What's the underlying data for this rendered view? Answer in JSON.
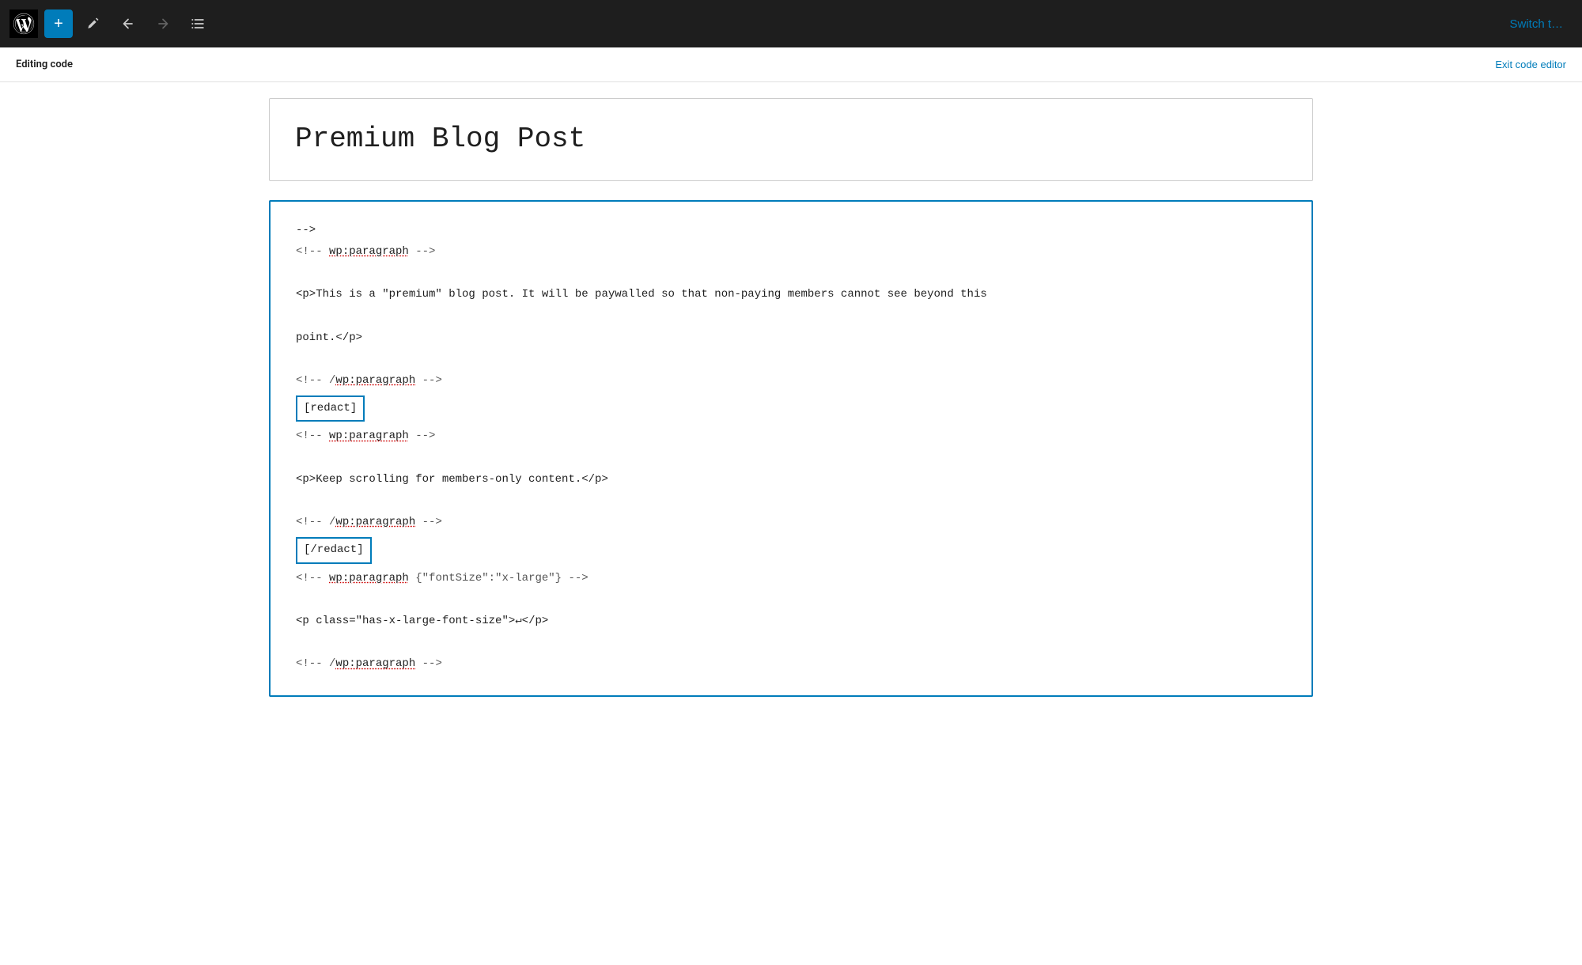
{
  "toolbar": {
    "add_label": "+",
    "switch_label": "Switch t…",
    "undo_title": "Undo",
    "redo_title": "Redo",
    "list_view_title": "List View",
    "edit_title": "Edit"
  },
  "editing_bar": {
    "label": "Editing code",
    "exit_label": "Exit code editor"
  },
  "post": {
    "title": "Premium Blog Post"
  },
  "code_editor": {
    "lines": [
      {
        "type": "comment",
        "content": "<!-- ",
        "tag": "wp:paragraph",
        "end": " -->"
      },
      {
        "type": "empty"
      },
      {
        "type": "text",
        "content": "<p>This is a \"premium\" blog post. It will be paywalled so that non-paying members cannot see beyond this"
      },
      {
        "type": "empty"
      },
      {
        "type": "text",
        "content": "point.</p>"
      },
      {
        "type": "empty"
      },
      {
        "type": "comment",
        "content": "<!-- /",
        "tag": "wp:paragraph",
        "end": " -->"
      },
      {
        "type": "shortcode",
        "content": "[redact]"
      },
      {
        "type": "comment",
        "content": "<!-- ",
        "tag": "wp:paragraph",
        "end": " -->"
      },
      {
        "type": "empty"
      },
      {
        "type": "text",
        "content": "<p>Keep scrolling for members-only content.</p>"
      },
      {
        "type": "empty"
      },
      {
        "type": "comment",
        "content": "<!-- /",
        "tag": "wp:paragraph",
        "end": " -->"
      },
      {
        "type": "shortcode",
        "content": "[/redact]"
      },
      {
        "type": "comment_attr",
        "content": "<!-- ",
        "tag": "wp:paragraph",
        "attr": " {\"fontSize\":\"x-large\"}",
        "end": " -->"
      },
      {
        "type": "empty"
      },
      {
        "type": "text",
        "content": "<p class=\"has-x-large-font-size\">↵</p>"
      },
      {
        "type": "empty"
      },
      {
        "type": "comment",
        "content": "<!-- /",
        "tag": "wp:paragraph",
        "end": " -->"
      }
    ]
  }
}
